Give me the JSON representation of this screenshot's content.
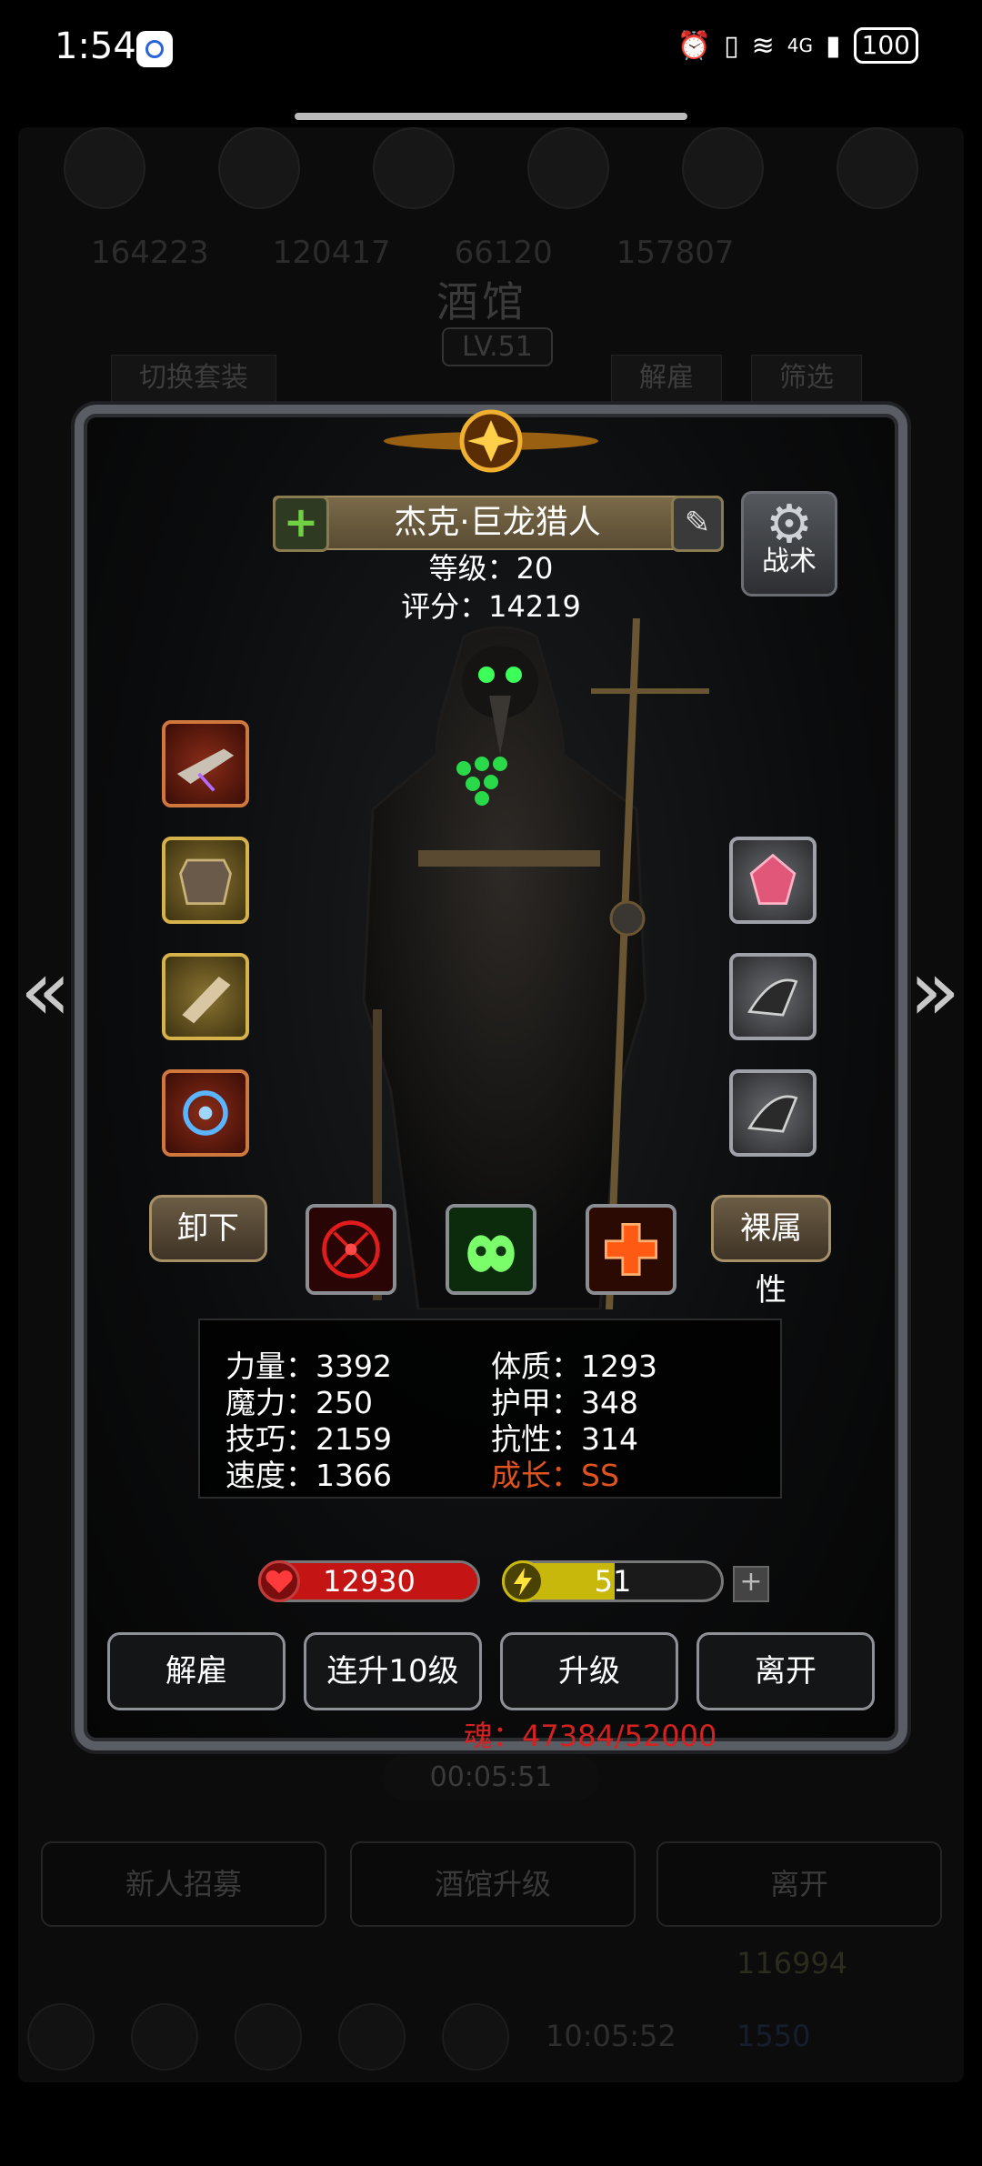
{
  "status": {
    "time": "1:54",
    "battery": "100",
    "network": "4G"
  },
  "background": {
    "numbers": [
      "164223",
      "120417",
      "66120",
      "157807"
    ],
    "title": "酒馆",
    "level_badge": "LV.51",
    "tab_switch_outfit": "切换套装",
    "tab_dismiss": "解雇",
    "tab_filter": "筛选",
    "timer": "00:05:51",
    "btn_recruit": "新人招募",
    "btn_upgrade_tavern": "酒馆升级",
    "btn_leave": "离开",
    "gold": "116994",
    "time2": "10:05:52",
    "blue_value": "1550"
  },
  "hero": {
    "name": "杰克·巨龙猎人",
    "level": "等级：20",
    "score": "评分：14219",
    "tactics_label": "战术"
  },
  "buttons": {
    "unequip": "卸下",
    "base_attr": "裸属性",
    "dismiss": "解雇",
    "level_up_10": "连升10级",
    "upgrade": "升级",
    "leave": "离开"
  },
  "stats": {
    "strength": "力量：3392",
    "magic": "魔力：250",
    "skill": "技巧：2159",
    "speed": "速度：1366",
    "constitution": "体质：1293",
    "armor": "护甲：348",
    "resistance": "抗性：314",
    "growth": "成长：SS"
  },
  "bars": {
    "hp": {
      "value": "12930",
      "fill": 1.0,
      "color": "#c41414"
    },
    "energy": {
      "value": "51",
      "fill": 0.51,
      "color": "#c9b80c"
    }
  },
  "soul": "魂：47384/52000",
  "colors": {
    "growth": "#e0531e",
    "soul": "#d32222"
  }
}
